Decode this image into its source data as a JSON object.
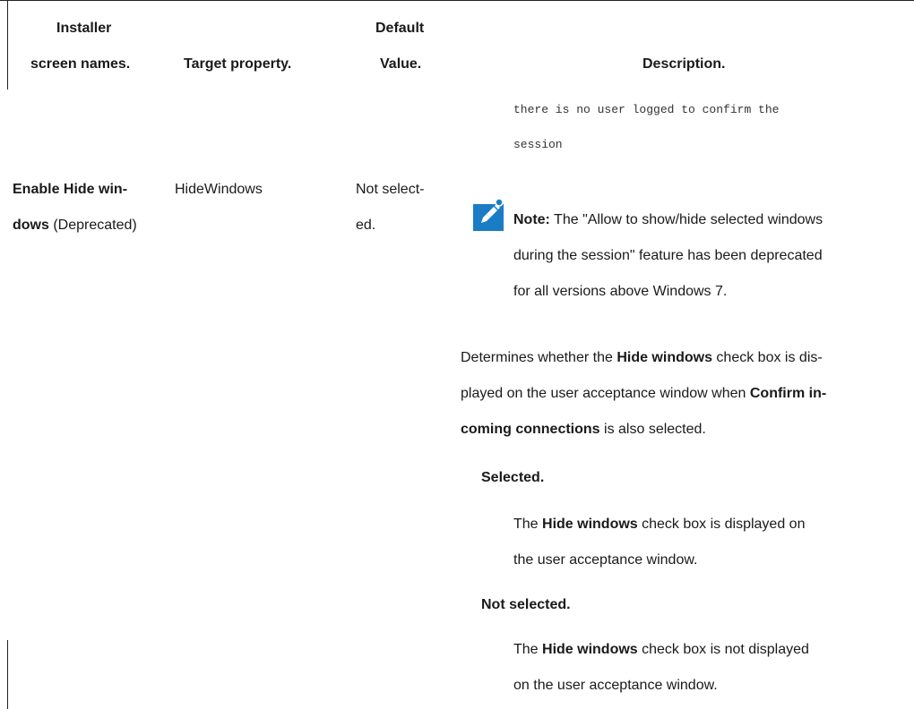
{
  "table": {
    "headers": {
      "installer_line1": "Installer",
      "installer_line2": "screen names.",
      "target_property": "Target property.",
      "default_line1": "Default",
      "default_line2": "Value.",
      "description": "Description."
    },
    "prev_row_code": {
      "line1": "there is no user logged to confirm the",
      "line2": "session"
    },
    "row": {
      "screen_name_bold_1": "Enable Hide win-",
      "screen_name_bold_2": "dows",
      "screen_name_suffix": " (Deprecated)",
      "target_property": "HideWindows",
      "default_line1": "Not select-",
      "default_line2": "ed.",
      "note": {
        "label": "Note:",
        "line1": " The \"Allow to show/hide selected windows",
        "line2": "during the session\" feature has been deprecated",
        "line3": "for all versions above Windows 7."
      },
      "desc": {
        "l1_pre": "Determines whether the ",
        "l1_bold": "Hide windows",
        "l1_post": " check box is dis-",
        "l2_pre": "played on the user acceptance window when ",
        "l2_bold": "Confirm in-",
        "l3_bold": "coming connections",
        "l3_post": " is also selected."
      },
      "options": [
        {
          "term": "Selected.",
          "l1_pre": "The ",
          "l1_bold": "Hide windows",
          "l1_post": " check box is displayed on",
          "l2": "the user acceptance window."
        },
        {
          "term": "Not selected.",
          "l1_pre": "The ",
          "l1_bold": "Hide windows",
          "l1_post": " check box is not displayed",
          "l2": "on the user acceptance window."
        }
      ]
    }
  },
  "colors": {
    "note_icon_bg": "#1b7cc6"
  },
  "icons": {
    "note": "pencil-note-icon"
  }
}
